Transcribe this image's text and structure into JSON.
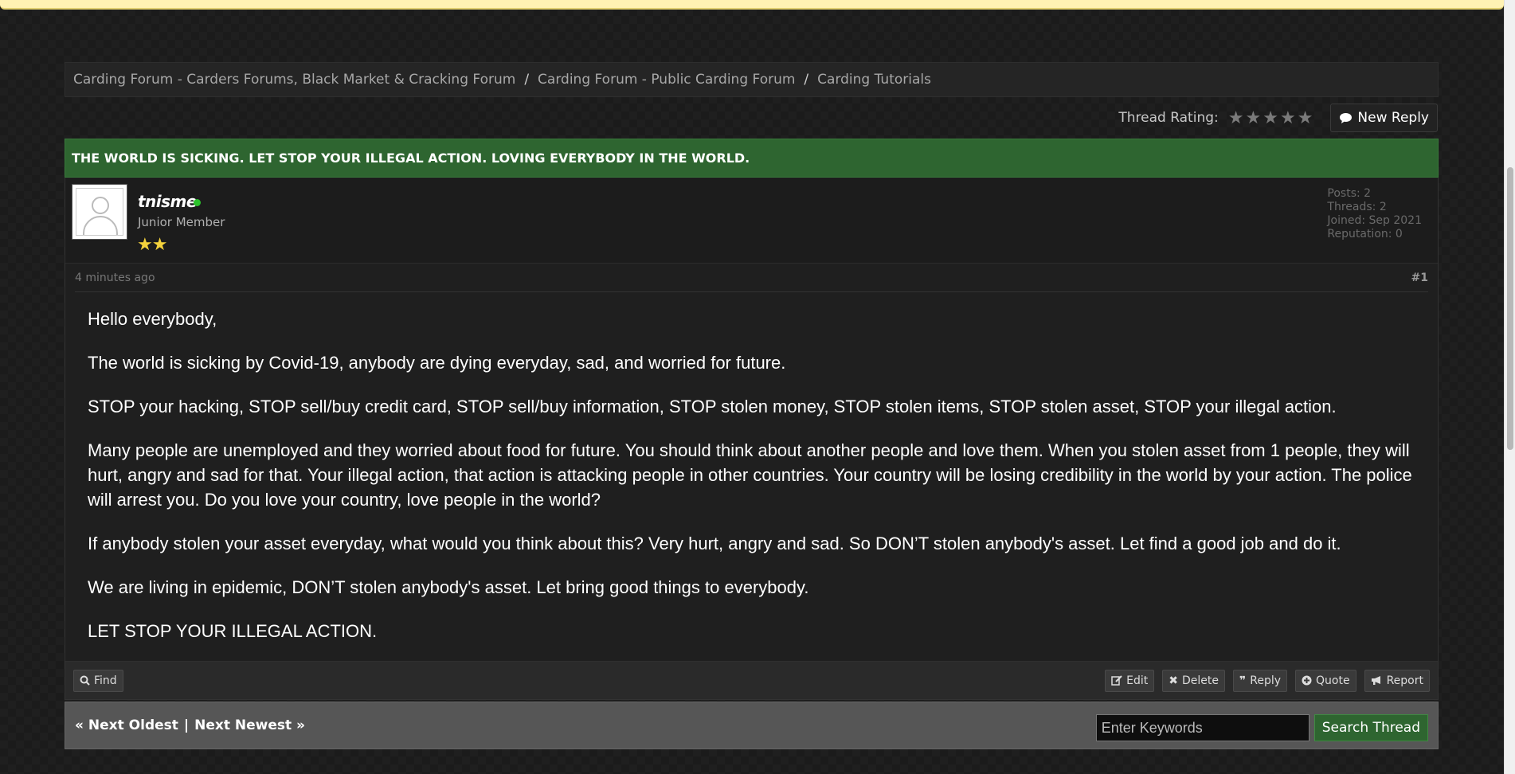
{
  "breadcrumb": [
    "Carding Forum - Carders Forums, Black Market & Cracking Forum",
    "Carding Forum - Public Carding Forum",
    "Carding Tutorials"
  ],
  "breadcrumb_sep": "/",
  "thread": {
    "rating_label": "Thread Rating:",
    "rating_value": 0,
    "rating_max": 5,
    "new_reply_label": "New Reply",
    "title": "THE WORLD IS SICKING. LET STOP YOUR ILLEGAL ACTION. LOVING EVERYBODY IN THE WORLD."
  },
  "post": {
    "username": "tnisme",
    "user_title": "Junior Member",
    "user_stars": "★★",
    "stats": {
      "posts": "Posts: 2",
      "threads": "Threads: 2",
      "joined": "Joined: Sep 2021",
      "reputation": "Reputation: 0"
    },
    "time": "4 minutes ago",
    "number": "#1",
    "body": [
      "Hello everybody,",
      "The world is sicking by Covid-19, anybody are dying everyday, sad, and worried for future.",
      "STOP your hacking, STOP sell/buy credit card, STOP sell/buy information, STOP stolen money, STOP stolen items, STOP stolen asset, STOP your illegal action.",
      "Many people are unemployed and they worried about food for future. You should think about another people and love them. When you stolen asset from 1 people, they will hurt, angry and sad for that. Your illegal action, that action is attacking people in other countries. Your country will be losing credibility in the world by your action. The police will arrest you. Do you love your country, love people in the world?",
      "If anybody stolen your asset everyday, what would you think about this? Very hurt, angry and sad. So DON’T stolen anybody's asset. Let find a good job and do it.",
      "We are living in epidemic, DON’T stolen anybody's asset. Let bring good things to everybody.",
      "LET STOP YOUR ILLEGAL ACTION."
    ],
    "actions": {
      "find": "Find",
      "edit": "Edit",
      "delete": "Delete",
      "reply": "Reply",
      "quote": "Quote",
      "report": "Report"
    }
  },
  "nav": {
    "next_oldest": "« Next Oldest",
    "separator": "|",
    "next_newest": "Next Newest »"
  },
  "search": {
    "placeholder": "Enter Keywords",
    "button": "Search Thread"
  },
  "colors": {
    "title_bar": "#2e6530",
    "online": "#2bc22b",
    "stars": "#f4d23c"
  },
  "icons": {
    "new_reply": "speech-bubble-icon",
    "find": "search-icon",
    "edit": "pencil-square-icon",
    "delete": "x-icon",
    "reply": "quote-marks-icon",
    "quote": "plus-circle-icon",
    "report": "megaphone-icon"
  }
}
